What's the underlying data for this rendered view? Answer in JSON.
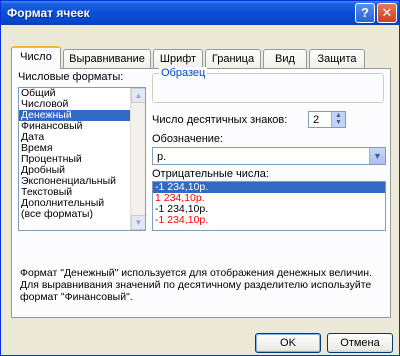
{
  "window": {
    "title": "Формат ячеек",
    "help_label": "?",
    "close_label": "✕"
  },
  "tabs": [
    {
      "label": "Число",
      "active": true
    },
    {
      "label": "Выравнивание",
      "active": false
    },
    {
      "label": "Шрифт",
      "active": false
    },
    {
      "label": "Граница",
      "active": false
    },
    {
      "label": "Вид",
      "active": false
    },
    {
      "label": "Защита",
      "active": false
    }
  ],
  "formats": {
    "label": "Числовые форматы:",
    "items": [
      "Общий",
      "Числовой",
      "Денежный",
      "Финансовый",
      "Дата",
      "Время",
      "Процентный",
      "Дробный",
      "Экспоненциальный",
      "Текстовый",
      "Дополнительный",
      "(все форматы)"
    ],
    "selected_index": 2
  },
  "sample": {
    "legend": "Образец"
  },
  "decimals": {
    "label": "Число десятичных знаков:",
    "value": "2"
  },
  "symbol": {
    "label": "Обозначение:",
    "value": "р."
  },
  "negatives": {
    "label": "Отрицательные числа:",
    "items": [
      {
        "text": "-1 234,10р.",
        "color": "#000000",
        "selected": true
      },
      {
        "text": "1 234,10р.",
        "color": "#ff0000",
        "selected": false
      },
      {
        "text": "-1 234,10р.",
        "color": "#000000",
        "selected": false
      },
      {
        "text": "-1 234,10р.",
        "color": "#ff0000",
        "selected": false
      }
    ]
  },
  "description": "Формат \"Денежный\" используется для отображения денежных величин. Для выравнивания значений по десятичному разделителю используйте формат \"Финансовый\".",
  "buttons": {
    "ok": "OK",
    "cancel": "Отмена"
  }
}
